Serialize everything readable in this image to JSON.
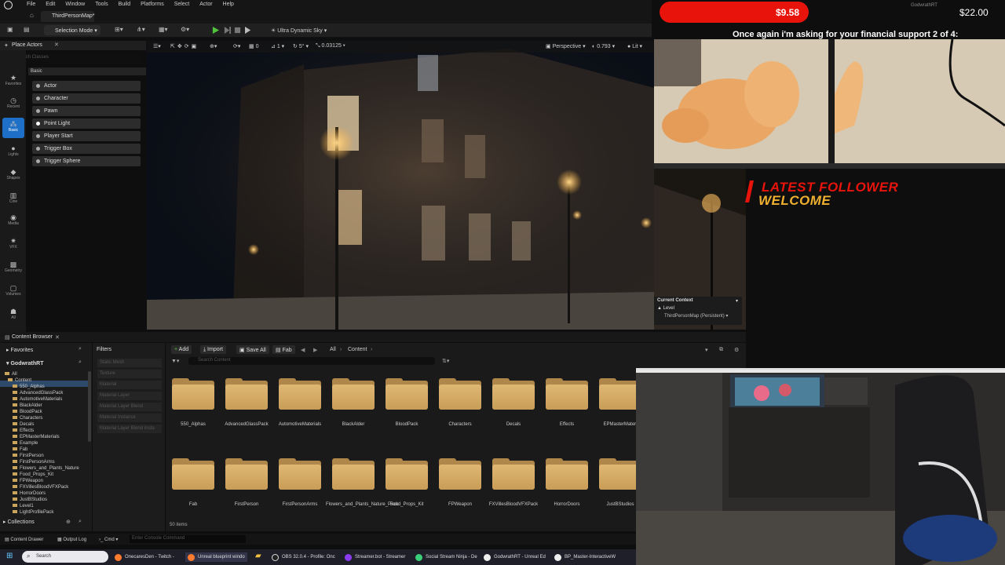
{
  "menu": [
    "File",
    "Edit",
    "Window",
    "Tools",
    "Build",
    "Platforms",
    "Select",
    "Actor",
    "Help"
  ],
  "tab": {
    "label": "ThirdPersonMap*"
  },
  "toolbar": {
    "selection_mode": "Selection Mode",
    "platform": "Ultra Dynamic Sky"
  },
  "viewport_bar": {
    "snap": "0.03125",
    "view": "Perspective",
    "fov": "0.793",
    "lit": "Lit",
    "v1": "0",
    "v2": "1",
    "v3": "5°"
  },
  "place_actors": {
    "title": "Place Actors",
    "search_placeholder": "Search Classes",
    "section": "Basic",
    "items": [
      "Actor",
      "Character",
      "Pawn",
      "Point Light",
      "Player Start",
      "Trigger Box",
      "Trigger Sphere"
    ]
  },
  "categories": [
    "Favorites",
    "Recent",
    "Basic",
    "Lights",
    "Shapes",
    "Cine",
    "Media",
    "VFX",
    "Geometry",
    "Volumes",
    "All"
  ],
  "current_context": {
    "title": "Current Context",
    "level_label": "Level",
    "map": "ThirdPersonMap (Persistent)"
  },
  "content_browser": {
    "tab": "Content Browser",
    "favorites": "Favorites",
    "project": "GodwrathRT",
    "collections": "Collections",
    "add": "Add",
    "import": "Import",
    "save_all": "Save All",
    "fab": "Fab",
    "path_all": "All",
    "path_content": "Content",
    "search_placeholder": "Search Content",
    "filters_label": "Filters",
    "item_count": "50 items",
    "filters": [
      "Static Mesh",
      "Texture",
      "Material",
      "Material Layer",
      "Material Layer Blend",
      "Material Instance",
      "Material Layer Blend Insta"
    ],
    "tree": [
      "All",
      "Content",
      "550_Alphas",
      "AdvancedGlassPack",
      "AutomotiveMaterials",
      "BlackAlder",
      "BloodPack",
      "Characters",
      "Decals",
      "Effects",
      "EPMasterMaterials",
      "Example",
      "Fab",
      "FirstPerson",
      "FirstPersonArms",
      "Flowers_and_Plants_Nature",
      "Food_Props_Kit",
      "FPWeapon",
      "FXVillesBloodVFXPack",
      "HorrorDoors",
      "JustBStudios",
      "Level1",
      "LightProfilePack"
    ],
    "folders_row1": [
      "550_Alphas",
      "AdvancedGlassPack",
      "AutomotiveMaterials",
      "BlackAlder",
      "BloodPack",
      "Characters",
      "Decals",
      "Effects",
      "EPMasterMateri"
    ],
    "folders_row2": [
      "Fab",
      "FirstPerson",
      "FirstPersonArms",
      "Flowers_and_Plants_Nature_Pack",
      "Food_Props_Kit",
      "FPWeapon",
      "FXVillesBloodVFXPack",
      "HorrorDoors",
      "JustBStudios"
    ]
  },
  "statusbar": {
    "drawer": "Content Drawer",
    "output": "Output Log",
    "cmd": "Cmd",
    "console_placeholder": "Enter Console Command"
  },
  "taskbar": {
    "search": "Search",
    "items": [
      "OnecaresDen - Twitch -",
      "Unreal blueprint windo",
      "OBS 32.0.4 - Profile: Onc",
      "Streamer.bot - Streamer",
      "Social Stream Ninja - De",
      "GodwrathRT - Unreal Ed",
      "BP_Master-InteractiveW"
    ]
  },
  "overlay": {
    "donation": "$9.58",
    "goal": "$22.00",
    "donor": "GodwrathRT",
    "ask": "Once again i'm asking for your financial support 2 of 4:",
    "latest_line1": "LATEST FOLLOWER",
    "latest_line2": "WELCOME"
  },
  "colors": {
    "accent": "#1e6fc7",
    "brand_red": "#e8140c",
    "folder": "#d4ab68",
    "play_green": "#4fc33b"
  }
}
